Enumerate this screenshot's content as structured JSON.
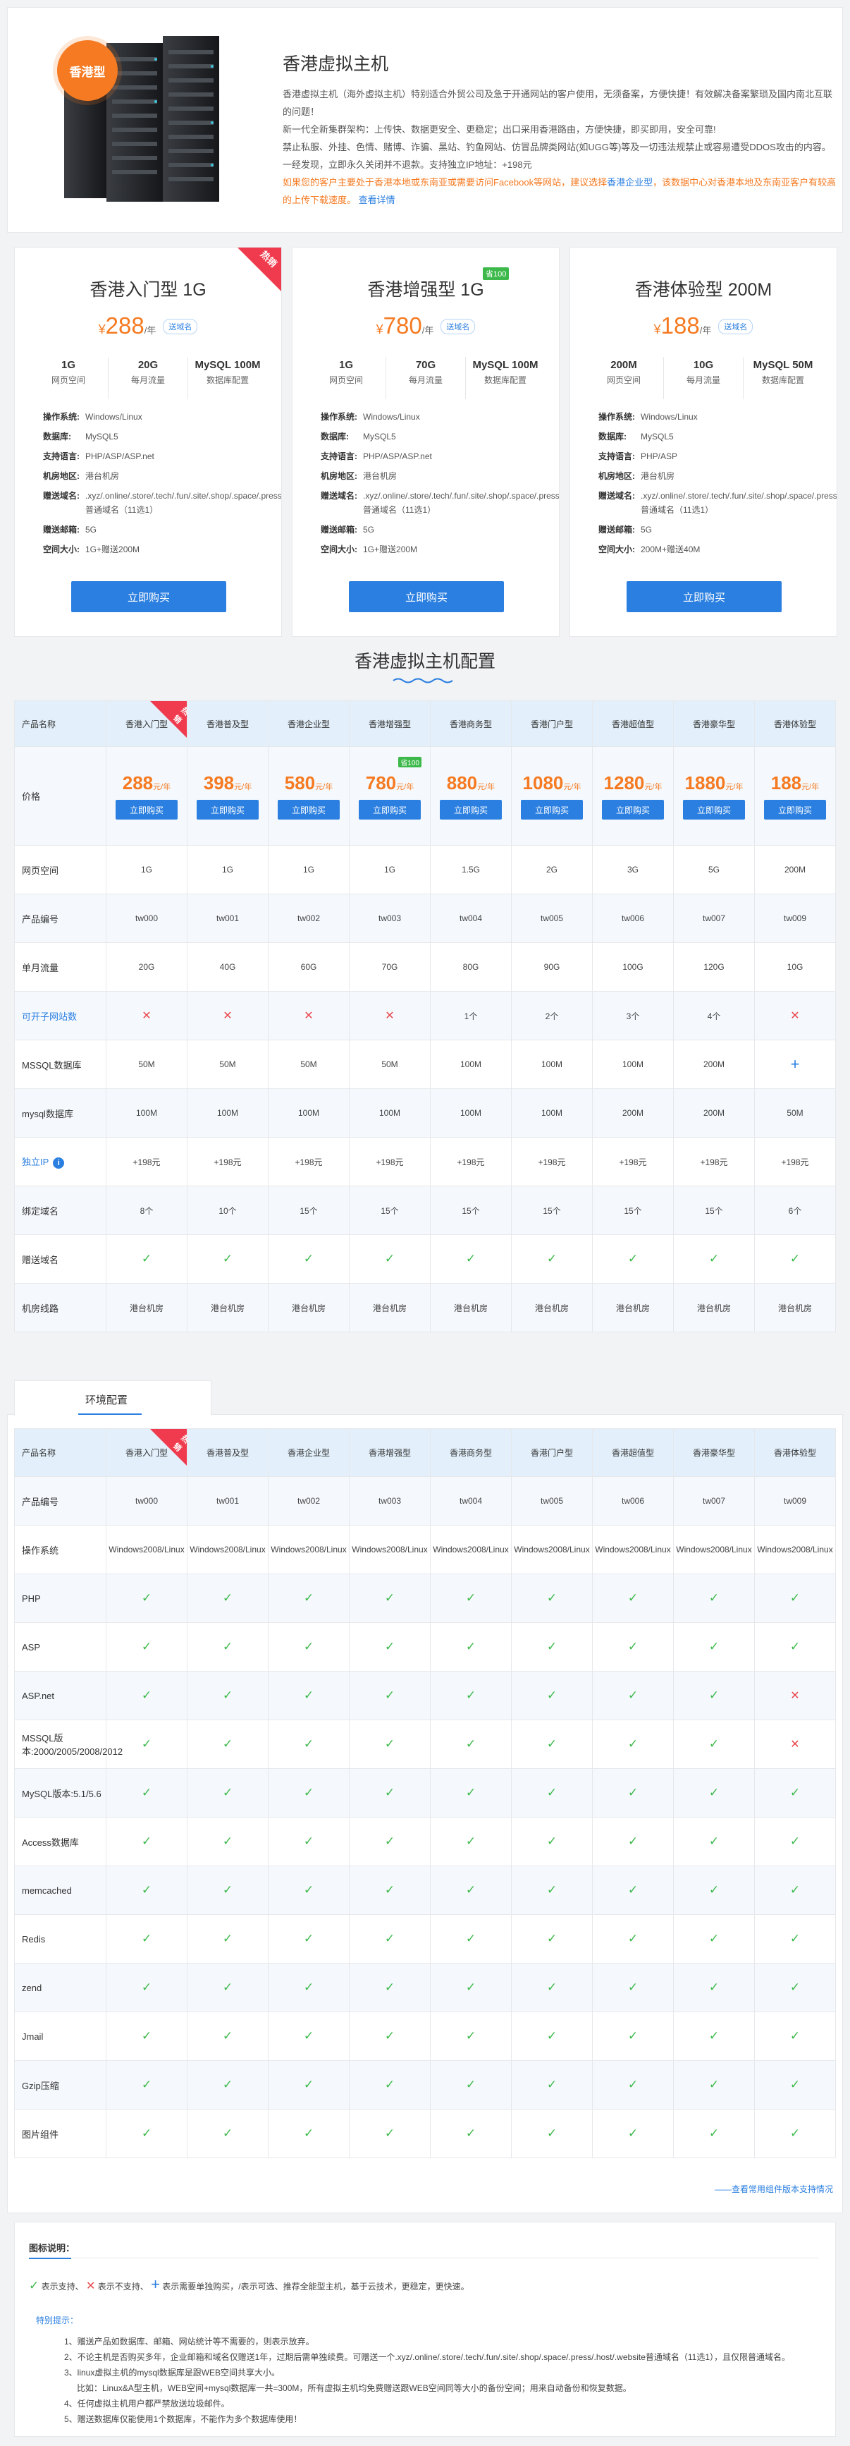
{
  "hero": {
    "badge": "香港型",
    "title": "香港虚拟主机",
    "paragraphs": [
      "香港虚拟主机（海外虚拟主机）特别适合外贸公司及急于开通网站的客户使用，无须备案，方便快捷！有效解决备案繁琐及国内南北互联的问题！",
      "新一代全新集群架构：上传快、数据更安全、更稳定；出口采用香港路由，方便快捷，即买即用，安全可靠!",
      "禁止私服、外挂、色情、赌博、诈骗、黑站、钓鱼网站、仿冒品牌类网站(如UGG等)等及一切违法规禁止或容易遭受DDOS攻击的内容。一经发现，立即永久关闭并不退款。支持独立IP地址：+198元"
    ],
    "warn": "如果您的客户主要处于香港本地或东南亚或需要访问Facebook等网站，建议选择",
    "warn_link": "香港企业型",
    "warn_tail": "，该数据中心对香港本地及东南亚客户有较高的上传下载速度。",
    "more_link": "查看详情"
  },
  "cards": [
    {
      "name": "香港入门型 1G",
      "hot": "热销",
      "badge": "",
      "symbol": "¥",
      "price": "288",
      "unit": "/年",
      "tag": "送域名",
      "stats": [
        {
          "v": "1G",
          "l": "网页空间"
        },
        {
          "v": "20G",
          "l": "每月流量"
        },
        {
          "v": "MySQL 100M",
          "l": "数据库配置"
        }
      ],
      "specs": [
        {
          "k": "操作系统:",
          "v": "Windows/Linux"
        },
        {
          "k": "数据库:",
          "v": "MySQL5"
        },
        {
          "k": "支持语言:",
          "v": "PHP/ASP/ASP.net"
        },
        {
          "k": "机房地区:",
          "v": "港台机房"
        },
        {
          "k": "赠送域名:",
          "v": ".xyz/.online/.store/.tech/.fun/.site/.shop/.space/.press/.host/.website普通域名（11选1）"
        },
        {
          "k": "赠送邮箱:",
          "v": "5G"
        },
        {
          "k": "空间大小:",
          "v": "1G+赠送200M"
        }
      ],
      "button": "立即购买"
    },
    {
      "name": "香港增强型 1G",
      "hot": "",
      "badge": "省100",
      "symbol": "¥",
      "price": "780",
      "unit": "/年",
      "tag": "送域名",
      "stats": [
        {
          "v": "1G",
          "l": "网页空间"
        },
        {
          "v": "70G",
          "l": "每月流量"
        },
        {
          "v": "MySQL 100M",
          "l": "数据库配置"
        }
      ],
      "specs": [
        {
          "k": "操作系统:",
          "v": "Windows/Linux"
        },
        {
          "k": "数据库:",
          "v": "MySQL5"
        },
        {
          "k": "支持语言:",
          "v": "PHP/ASP/ASP.net"
        },
        {
          "k": "机房地区:",
          "v": "港台机房"
        },
        {
          "k": "赠送域名:",
          "v": ".xyz/.online/.store/.tech/.fun/.site/.shop/.space/.press/.host/.website普通域名（11选1）"
        },
        {
          "k": "赠送邮箱:",
          "v": "5G"
        },
        {
          "k": "空间大小:",
          "v": "1G+赠送200M"
        }
      ],
      "button": "立即购买"
    },
    {
      "name": "香港体验型 200M",
      "hot": "",
      "badge": "",
      "symbol": "¥",
      "price": "188",
      "unit": "/年",
      "tag": "送域名",
      "stats": [
        {
          "v": "200M",
          "l": "网页空间"
        },
        {
          "v": "10G",
          "l": "每月流量"
        },
        {
          "v": "MySQL 50M",
          "l": "数据库配置"
        }
      ],
      "specs": [
        {
          "k": "操作系统:",
          "v": "Windows/Linux"
        },
        {
          "k": "数据库:",
          "v": "MySQL5"
        },
        {
          "k": "支持语言:",
          "v": "PHP/ASP"
        },
        {
          "k": "机房地区:",
          "v": "港台机房"
        },
        {
          "k": "赠送域名:",
          "v": ".xyz/.online/.store/.tech/.fun/.site/.shop/.space/.press/.host/.website普通域名（11选1）"
        },
        {
          "k": "赠送邮箱:",
          "v": "5G"
        },
        {
          "k": "空间大小:",
          "v": "200M+赠送40M"
        }
      ],
      "button": "立即购买"
    }
  ],
  "config": {
    "title": "香港虚拟主机配置",
    "header_label": "产品名称",
    "plans": [
      "香港入门型",
      "香港普及型",
      "香港企业型",
      "香港增强型",
      "香港商务型",
      "香港门户型",
      "香港超值型",
      "香港豪华型",
      "香港体验型"
    ],
    "hot": "热销",
    "price_label": "价格",
    "prices": [
      "288",
      "398",
      "580",
      "780",
      "880",
      "1080",
      "1280",
      "1880",
      "188"
    ],
    "price_unit": "元/年",
    "price_badge": "省100",
    "buy": "立即购买",
    "rows": [
      {
        "label": "网页空间",
        "link": false,
        "vals": [
          "1G",
          "1G",
          "1G",
          "1G",
          "1.5G",
          "2G",
          "3G",
          "5G",
          "200M"
        ]
      },
      {
        "label": "产品编号",
        "link": false,
        "vals": [
          "tw000",
          "tw001",
          "tw002",
          "tw003",
          "tw004",
          "tw005",
          "tw006",
          "tw007",
          "tw009"
        ]
      },
      {
        "label": "单月流量",
        "link": false,
        "vals": [
          "20G",
          "40G",
          "60G",
          "70G",
          "80G",
          "90G",
          "100G",
          "120G",
          "10G"
        ]
      },
      {
        "label": "可开子网站数",
        "link": true,
        "vals": [
          "x",
          "x",
          "x",
          "x",
          "1个",
          "2个",
          "3个",
          "4个",
          "x"
        ]
      },
      {
        "label": "MSSQL数据库",
        "link": false,
        "vals": [
          "50M",
          "50M",
          "50M",
          "50M",
          "100M",
          "100M",
          "100M",
          "200M",
          "+"
        ]
      },
      {
        "label": "mysql数据库",
        "link": false,
        "vals": [
          "100M",
          "100M",
          "100M",
          "100M",
          "100M",
          "100M",
          "200M",
          "200M",
          "50M"
        ]
      },
      {
        "label": "独立IP",
        "link": true,
        "info": true,
        "vals": [
          "+198元",
          "+198元",
          "+198元",
          "+198元",
          "+198元",
          "+198元",
          "+198元",
          "+198元",
          "+198元"
        ]
      },
      {
        "label": "绑定域名",
        "link": false,
        "vals": [
          "8个",
          "10个",
          "15个",
          "15个",
          "15个",
          "15个",
          "15个",
          "15个",
          "6个"
        ]
      },
      {
        "label": "赠送域名",
        "link": false,
        "vals": [
          "v",
          "v",
          "v",
          "v",
          "v",
          "v",
          "v",
          "v",
          "v"
        ]
      },
      {
        "label": "机房线路",
        "link": false,
        "vals": [
          "港台机房",
          "港台机房",
          "港台机房",
          "港台机房",
          "港台机房",
          "港台机房",
          "港台机房",
          "港台机房",
          "港台机房"
        ]
      }
    ]
  },
  "env": {
    "tab": "环境配置",
    "header_label": "产品名称",
    "rows": [
      {
        "label": "产品编号",
        "vals": [
          "tw000",
          "tw001",
          "tw002",
          "tw003",
          "tw004",
          "tw005",
          "tw006",
          "tw007",
          "tw009"
        ]
      },
      {
        "label": "操作系统",
        "vals": [
          "Windows2008/Linux",
          "Windows2008/Linux",
          "Windows2008/Linux",
          "Windows2008/Linux",
          "Windows2008/Linux",
          "Windows2008/Linux",
          "Windows2008/Linux",
          "Windows2008/Linux",
          "Windows2008/Linux"
        ]
      },
      {
        "label": "PHP",
        "vals": [
          "v",
          "v",
          "v",
          "v",
          "v",
          "v",
          "v",
          "v",
          "v"
        ]
      },
      {
        "label": "ASP",
        "vals": [
          "v",
          "v",
          "v",
          "v",
          "v",
          "v",
          "v",
          "v",
          "v"
        ]
      },
      {
        "label": "ASP.net",
        "vals": [
          "v",
          "v",
          "v",
          "v",
          "v",
          "v",
          "v",
          "v",
          "x"
        ]
      },
      {
        "label": "MSSQL版本:2000/2005/2008/2012",
        "vals": [
          "v",
          "v",
          "v",
          "v",
          "v",
          "v",
          "v",
          "v",
          "x"
        ]
      },
      {
        "label": "MySQL版本:5.1/5.6",
        "vals": [
          "v",
          "v",
          "v",
          "v",
          "v",
          "v",
          "v",
          "v",
          "v"
        ]
      },
      {
        "label": "Access数据库",
        "vals": [
          "v",
          "v",
          "v",
          "v",
          "v",
          "v",
          "v",
          "v",
          "v"
        ]
      },
      {
        "label": "memcached",
        "vals": [
          "v",
          "v",
          "v",
          "v",
          "v",
          "v",
          "v",
          "v",
          "v"
        ]
      },
      {
        "label": "Redis",
        "vals": [
          "v",
          "v",
          "v",
          "v",
          "v",
          "v",
          "v",
          "v",
          "v"
        ]
      },
      {
        "label": "zend",
        "vals": [
          "v",
          "v",
          "v",
          "v",
          "v",
          "v",
          "v",
          "v",
          "v"
        ]
      },
      {
        "label": "Jmail",
        "vals": [
          "v",
          "v",
          "v",
          "v",
          "v",
          "v",
          "v",
          "v",
          "v"
        ]
      },
      {
        "label": "Gzip压缩",
        "vals": [
          "v",
          "v",
          "v",
          "v",
          "v",
          "v",
          "v",
          "v",
          "v"
        ]
      },
      {
        "label": "图片组件",
        "vals": [
          "v",
          "v",
          "v",
          "v",
          "v",
          "v",
          "v",
          "v",
          "v"
        ]
      }
    ],
    "more_link": "——查看常用组件版本支持情况"
  },
  "legend": {
    "title": "图标说明：",
    "items": [
      "表示支持、",
      "表示不支持、",
      "表示需要单独购买，/表示可选、推荐全能型主机，基于云技术，更稳定，更快速。"
    ],
    "tips_title": "特别提示：",
    "tips": [
      "1、赠送产品如数据库、邮箱、网站统计等不需要的，则表示放弃。",
      "2、不论主机是否购买多年，企业邮箱和域名仅赠送1年，过期后需单独续费。可赠送一个.xyz/.online/.store/.tech/.fun/.site/.shop/.space/.press/.host/.website普通域名（11选1），且仅限普通域名。",
      "3、linux虚拟主机的mysql数据库是跟WEB空间共享大小。",
      "比如：Linux&A型主机，WEB空间+mysql数据库一共=300M，所有虚拟主机均免费赠送跟WEB空间同等大小的备份空间；用来自动备份和恢复数据。",
      "4、任何虚拟主机用户都严禁放送垃圾邮件。",
      "5、赠送数据库仅能使用1个数据库，不能作为多个数据库使用！"
    ]
  },
  "colors": {
    "accent": "#2b7fe0",
    "price": "#f57a21",
    "hot": "#f03a4d",
    "ok": "#3cb94a",
    "bad": "#e9474d"
  }
}
